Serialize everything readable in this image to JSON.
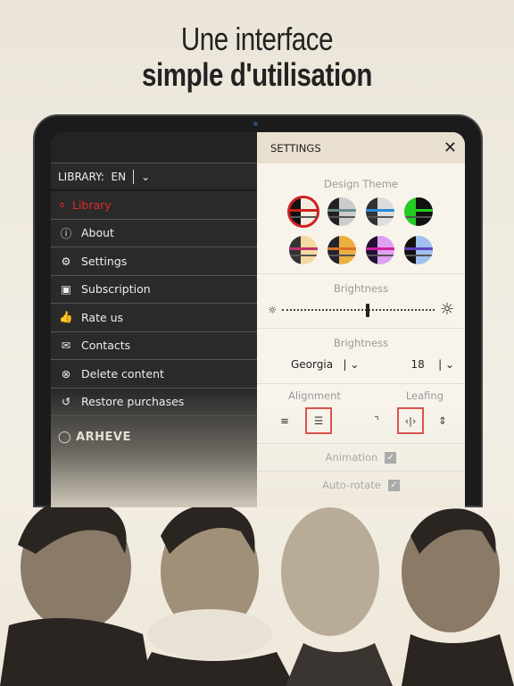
{
  "headline": {
    "line1": "Une interface",
    "line2": "simple d'utilisation"
  },
  "menu": {
    "library_label": "LIBRARY:",
    "language": "EN",
    "items": [
      {
        "label": "Library",
        "icon": "dot-icon",
        "active": true
      },
      {
        "label": "About",
        "icon": "info-icon"
      },
      {
        "label": "Settings",
        "icon": "gear-icon"
      },
      {
        "label": "Subscription",
        "icon": "wallet-icon"
      },
      {
        "label": "Rate us",
        "icon": "thumbs-up-icon"
      },
      {
        "label": "Contacts",
        "icon": "envelope-icon"
      },
      {
        "label": "Delete content",
        "icon": "close-circle-icon"
      },
      {
        "label": "Restore purchases",
        "icon": "restore-icon"
      }
    ],
    "logo": "ARHEVE"
  },
  "settings": {
    "title": "SETTINGS",
    "design_theme": "Design Theme",
    "brightness": "Brightness",
    "brightness_level": 0.55,
    "font_section": "Brightness",
    "font": "Georgia",
    "font_size": "18",
    "alignment": "Alignment",
    "leafing": "Leafing",
    "animation": "Animation",
    "auto_rotate": "Auto-rotate",
    "accent": "#d12020",
    "themes": [
      [
        "#111",
        "#f3ecdf",
        "#d12020"
      ],
      [
        "#222",
        "#ccc",
        "#6a8a8a"
      ],
      [
        "#333",
        "#ddd",
        "#2a8ad8"
      ],
      [
        "#22cc22",
        "#111",
        "#22cc22"
      ],
      [
        "#333",
        "#f4d9a0",
        "#c0306a"
      ],
      [
        "#223",
        "#eab040",
        "#e07020"
      ],
      [
        "#213",
        "#e0a0f0",
        "#d020a0"
      ],
      [
        "#111",
        "#a0c0f0",
        "#6040c0"
      ]
    ]
  }
}
